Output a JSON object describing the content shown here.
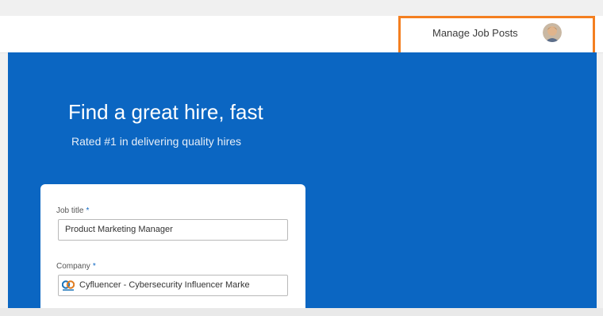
{
  "header": {
    "manage_link": "Manage Job Posts",
    "avatar_icon": "user-avatar"
  },
  "hero": {
    "title": "Find a great hire, fast",
    "subtitle": "Rated #1 in delivering quality hires",
    "background_color": "#0b66c2"
  },
  "form": {
    "job_title_label": "Job title",
    "job_title_value": "Product Marketing Manager",
    "company_label": "Company",
    "company_value": "Cyfluencer - Cybersecurity Influencer Marke",
    "company_logo_icon": "company-logo",
    "required_marker": "*"
  },
  "highlight_color": "#f47f20"
}
